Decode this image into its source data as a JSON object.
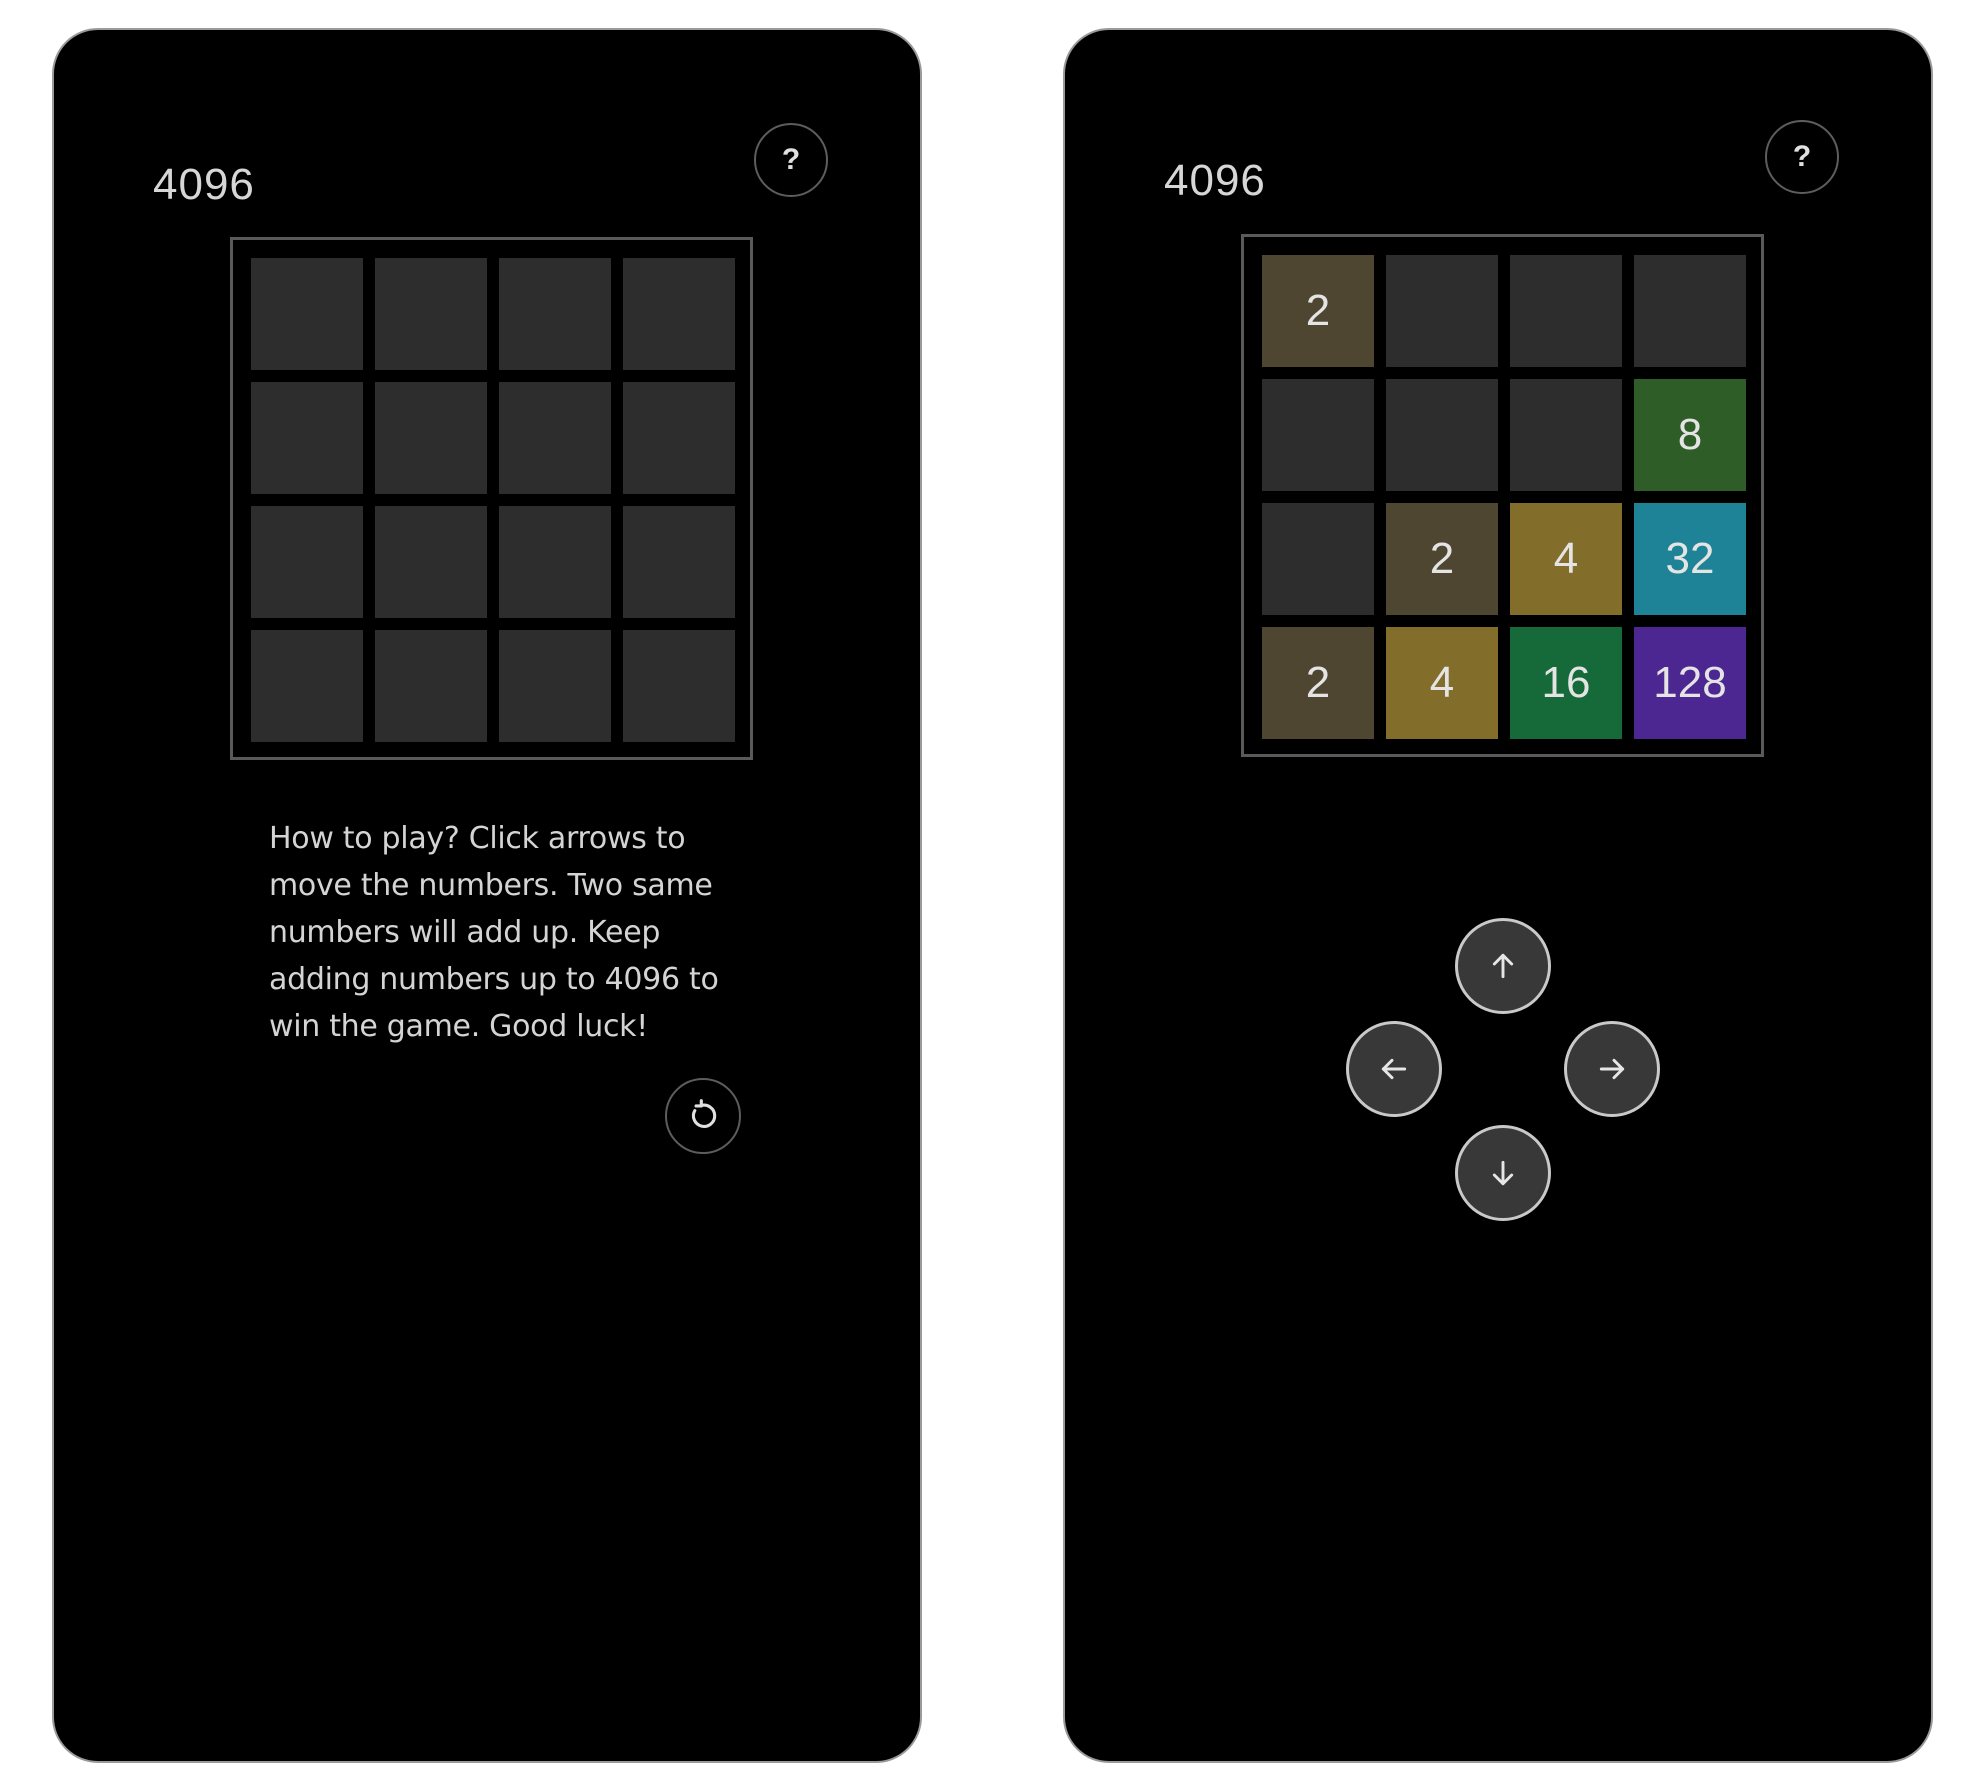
{
  "left_screen": {
    "title": "4096",
    "help_label": "?",
    "board": [
      [
        null,
        null,
        null,
        null
      ],
      [
        null,
        null,
        null,
        null
      ],
      [
        null,
        null,
        null,
        null
      ],
      [
        null,
        null,
        null,
        null
      ]
    ],
    "instructions": "How to play? Click arrows to move the numbers. Two same numbers will add up. Keep adding numbers up to 4096 to win the game. Good luck!",
    "restart_icon": "restart-icon"
  },
  "right_screen": {
    "title": "4096",
    "help_label": "?",
    "board": [
      [
        2,
        null,
        null,
        null
      ],
      [
        null,
        null,
        null,
        8
      ],
      [
        null,
        2,
        4,
        32
      ],
      [
        2,
        4,
        16,
        128
      ]
    ],
    "controls": {
      "up_icon": "arrow-up-icon",
      "left_icon": "arrow-left-icon",
      "right_icon": "arrow-right-icon",
      "down_icon": "arrow-down-icon"
    }
  },
  "tile_colors": {
    "empty": "#2d2d2d",
    "2": "#4f4632",
    "4": "#836d2a",
    "8": "#2f5d28",
    "16": "#166a3a",
    "32": "#1e8396",
    "128": "#4d2791"
  }
}
